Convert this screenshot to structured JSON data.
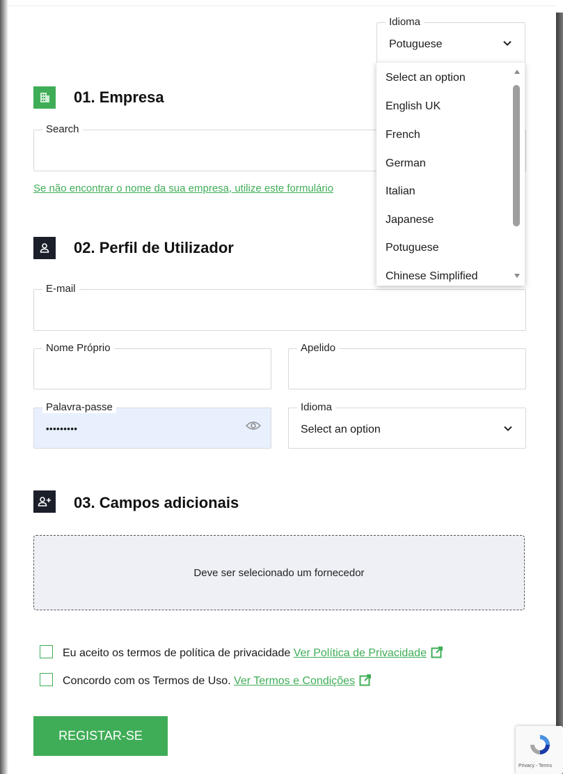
{
  "header": {
    "language_label": "Idioma",
    "language_value": "Potuguese"
  },
  "language_dropdown": {
    "options": [
      "Select an option",
      "English UK",
      "French",
      "German",
      "Italian",
      "Japanese",
      "Potuguese",
      "Chinese Simplified"
    ]
  },
  "section1": {
    "title": "01. Empresa",
    "search_label": "Search",
    "search_value": "",
    "link_text": "Se não encontrar o nome da sua empresa, utilize este formulário"
  },
  "section2": {
    "title": "02. Perfil de Utilizador",
    "email_label": "E-mail",
    "first_name_label": "Nome Próprio",
    "last_name_label": "Apelido",
    "password_label": "Palavra-passe",
    "password_value": "•••••••••",
    "language_label": "Idioma",
    "language_value": "Select an option"
  },
  "section3": {
    "title": "03. Campos adicionais",
    "supplier_message": "Deve ser selecionado um fornecedor"
  },
  "consents": {
    "privacy_text": "Eu aceito os termos de política de privacidade",
    "privacy_link": "Ver Política de Privacidade",
    "terms_text": "Concordo com os Termos de Uso.",
    "terms_link": "Ver Termos e Condições"
  },
  "register_button": "REGISTAR-SE",
  "recaptcha": {
    "footer": "Privacy - Terms"
  },
  "colors": {
    "accent": "#3fad57",
    "dark_icon": "#1b1f2a",
    "autofill": "#e8f0fe"
  }
}
